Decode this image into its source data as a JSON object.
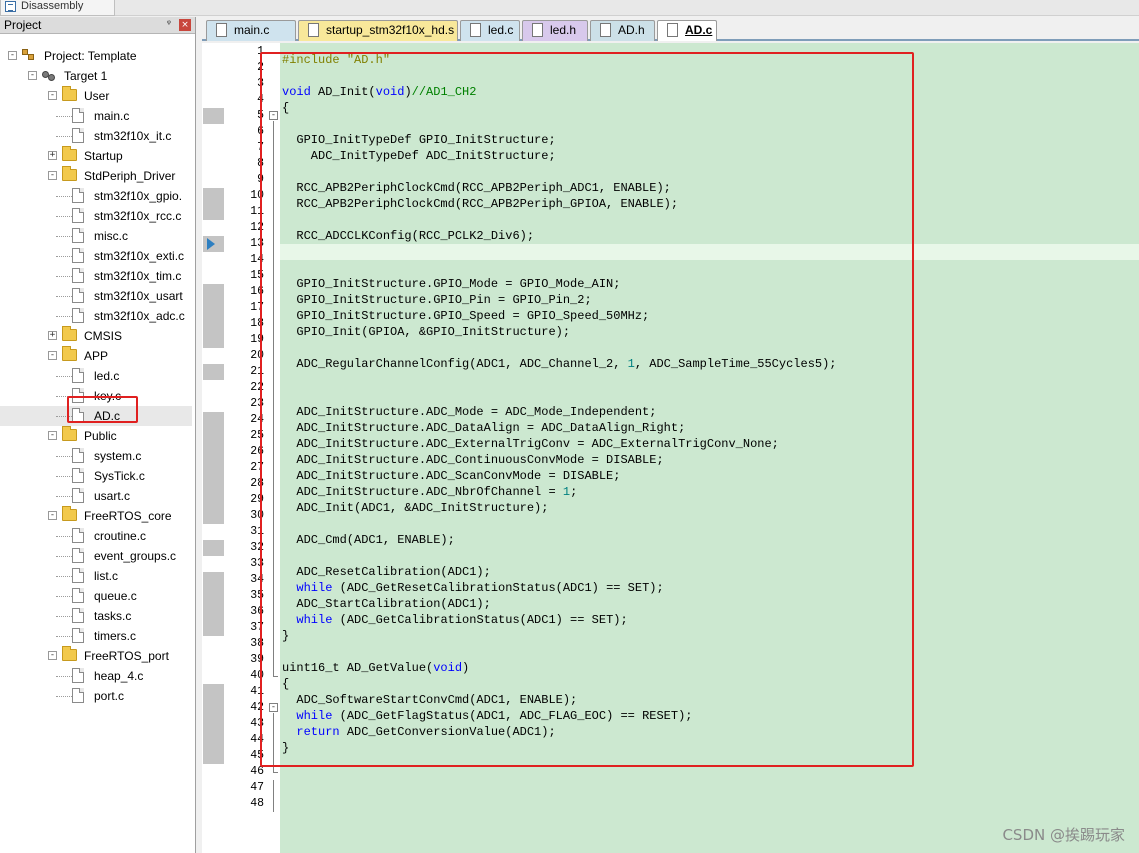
{
  "topbar": {
    "disassembly_label": "Disassembly"
  },
  "project": {
    "title": "Project",
    "pin_glyph": "ᵠ",
    "close_glyph": "×",
    "tree": [
      {
        "label": "Project: Template",
        "level": 0,
        "type": "project",
        "toggle": "-"
      },
      {
        "label": "Target 1",
        "level": 1,
        "type": "target",
        "toggle": "-"
      },
      {
        "label": "User",
        "level": 2,
        "type": "folder",
        "toggle": "-"
      },
      {
        "label": "main.c",
        "level": 3,
        "type": "file"
      },
      {
        "label": "stm32f10x_it.c",
        "level": 3,
        "type": "file"
      },
      {
        "label": "Startup",
        "level": 2,
        "type": "folder",
        "toggle": "+"
      },
      {
        "label": "StdPeriph_Driver",
        "level": 2,
        "type": "folder",
        "toggle": "-"
      },
      {
        "label": "stm32f10x_gpio.",
        "level": 3,
        "type": "file"
      },
      {
        "label": "stm32f10x_rcc.c",
        "level": 3,
        "type": "file"
      },
      {
        "label": "misc.c",
        "level": 3,
        "type": "file"
      },
      {
        "label": "stm32f10x_exti.c",
        "level": 3,
        "type": "file"
      },
      {
        "label": "stm32f10x_tim.c",
        "level": 3,
        "type": "file"
      },
      {
        "label": "stm32f10x_usart",
        "level": 3,
        "type": "file"
      },
      {
        "label": "stm32f10x_adc.c",
        "level": 3,
        "type": "file"
      },
      {
        "label": "CMSIS",
        "level": 2,
        "type": "folder",
        "toggle": "+"
      },
      {
        "label": "APP",
        "level": 2,
        "type": "folder",
        "toggle": "-"
      },
      {
        "label": "led.c",
        "level": 3,
        "type": "file"
      },
      {
        "label": "key.c",
        "level": 3,
        "type": "file"
      },
      {
        "label": "AD.c",
        "level": 3,
        "type": "file",
        "selected": true
      },
      {
        "label": "Public",
        "level": 2,
        "type": "folder",
        "toggle": "-"
      },
      {
        "label": "system.c",
        "level": 3,
        "type": "file"
      },
      {
        "label": "SysTick.c",
        "level": 3,
        "type": "file"
      },
      {
        "label": "usart.c",
        "level": 3,
        "type": "file"
      },
      {
        "label": "FreeRTOS_core",
        "level": 2,
        "type": "folder",
        "toggle": "-"
      },
      {
        "label": "croutine.c",
        "level": 3,
        "type": "file"
      },
      {
        "label": "event_groups.c",
        "level": 3,
        "type": "file"
      },
      {
        "label": "list.c",
        "level": 3,
        "type": "file"
      },
      {
        "label": "queue.c",
        "level": 3,
        "type": "file"
      },
      {
        "label": "tasks.c",
        "level": 3,
        "type": "file"
      },
      {
        "label": "timers.c",
        "level": 3,
        "type": "file"
      },
      {
        "label": "FreeRTOS_port",
        "level": 2,
        "type": "folder",
        "toggle": "-"
      },
      {
        "label": "heap_4.c",
        "level": 3,
        "type": "file"
      },
      {
        "label": "port.c",
        "level": 3,
        "type": "file"
      }
    ]
  },
  "tabs": [
    {
      "label": "main.c",
      "kind": "c"
    },
    {
      "label": "startup_stm32f10x_hd.s",
      "kind": "s"
    },
    {
      "label": "led.c",
      "kind": "c"
    },
    {
      "label": "led.h",
      "kind": "h"
    },
    {
      "label": "AD.h",
      "kind": "ah"
    },
    {
      "label": "AD.c",
      "kind": "active"
    }
  ],
  "editor": {
    "line_count": 48,
    "current_line": 13,
    "marked_lines": [
      5,
      10,
      11,
      13,
      16,
      17,
      18,
      19,
      21,
      24,
      25,
      26,
      27,
      28,
      29,
      30,
      32,
      34,
      35,
      36,
      37,
      41,
      42,
      43,
      44,
      45
    ],
    "code": [
      "#include \"AD.h\"",
      "",
      "void AD_Init(void)//AD1_CH2",
      "{",
      "",
      "  GPIO_InitTypeDef GPIO_InitStructure;",
      "    ADC_InitTypeDef ADC_InitStructure;",
      "",
      "  RCC_APB2PeriphClockCmd(RCC_APB2Periph_ADC1, ENABLE);",
      "  RCC_APB2PeriphClockCmd(RCC_APB2Periph_GPIOA, ENABLE);",
      "",
      "  RCC_ADCCLKConfig(RCC_PCLK2_Div6);",
      "",
      "",
      "  GPIO_InitStructure.GPIO_Mode = GPIO_Mode_AIN;",
      "  GPIO_InitStructure.GPIO_Pin = GPIO_Pin_2;",
      "  GPIO_InitStructure.GPIO_Speed = GPIO_Speed_50MHz;",
      "  GPIO_Init(GPIOA, &GPIO_InitStructure);",
      "",
      "  ADC_RegularChannelConfig(ADC1, ADC_Channel_2, 1, ADC_SampleTime_55Cycles5);",
      "",
      "",
      "  ADC_InitStructure.ADC_Mode = ADC_Mode_Independent;",
      "  ADC_InitStructure.ADC_DataAlign = ADC_DataAlign_Right;",
      "  ADC_InitStructure.ADC_ExternalTrigConv = ADC_ExternalTrigConv_None;",
      "  ADC_InitStructure.ADC_ContinuousConvMode = DISABLE;",
      "  ADC_InitStructure.ADC_ScanConvMode = DISABLE;",
      "  ADC_InitStructure.ADC_NbrOfChannel = 1;",
      "  ADC_Init(ADC1, &ADC_InitStructure);",
      "",
      "  ADC_Cmd(ADC1, ENABLE);",
      "",
      "  ADC_ResetCalibration(ADC1);",
      "  while (ADC_GetResetCalibrationStatus(ADC1) == SET);",
      "  ADC_StartCalibration(ADC1);",
      "  while (ADC_GetCalibrationStatus(ADC1) == SET);",
      "}",
      "",
      "uint16_t AD_GetValue(void)",
      "{",
      "  ADC_SoftwareStartConvCmd(ADC1, ENABLE);",
      "  while (ADC_GetFlagStatus(ADC1, ADC_FLAG_EOC) == RESET);",
      "  return ADC_GetConversionValue(ADC1);",
      "}",
      "",
      "",
      "",
      ""
    ]
  },
  "watermark": "CSDN @挨踢玩家",
  "colors": {
    "editor_bg": "#cce8d0",
    "highlight_box": "#e02020",
    "keyword": "#0000ff",
    "preprocessor": "#808000",
    "string": "#800000",
    "comment": "#008000",
    "number": "#008080"
  }
}
